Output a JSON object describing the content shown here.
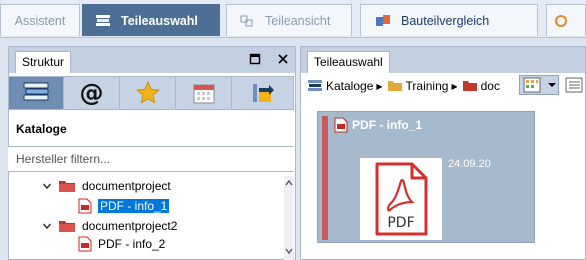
{
  "tabs": [
    {
      "label": "Assistent",
      "active": false,
      "icon": "none"
    },
    {
      "label": "Teileauswahl",
      "active": true,
      "icon": "books-icon"
    },
    {
      "label": "Teileansicht",
      "active": false,
      "icon": "cubes-icon"
    },
    {
      "label": "Bauteilvergleich",
      "active": false,
      "icon": "compare-icon"
    }
  ],
  "left_panel": {
    "tab_label": "Struktur",
    "section_title": "Kataloge",
    "filter_placeholder": "Hersteller filtern...",
    "tree": [
      {
        "label": "documentproject",
        "type": "folder",
        "expanded": true
      },
      {
        "label": "PDF - info_1",
        "type": "pdf",
        "selected": true
      },
      {
        "label": "documentproject2",
        "type": "folder",
        "expanded": true
      },
      {
        "label": "PDF - info_2",
        "type": "pdf",
        "selected": false
      }
    ]
  },
  "right_panel": {
    "tab_label": "Teileauswahl",
    "breadcrumbs": [
      "Kataloge",
      "Training",
      "doc"
    ],
    "card": {
      "title": "PDF - info_1",
      "date": "24.09.20",
      "thumb_label": "PDF"
    }
  },
  "colors": {
    "accent": "#4d6f96",
    "pdf_red": "#d32f2f",
    "folder_red": "#c0392b",
    "selection": "#0078d7"
  }
}
